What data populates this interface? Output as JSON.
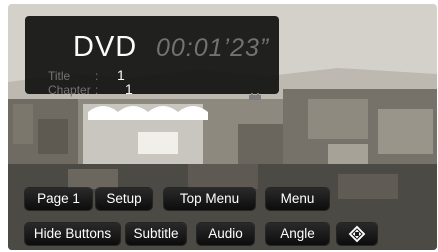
{
  "info": {
    "source": "DVD",
    "time": "00:01’23”",
    "title_label": "Title",
    "title_value": "1",
    "chapter_label": "Chapter",
    "chapter_value": "1",
    "colon": ":"
  },
  "buttons": {
    "row1": [
      "Page 1",
      "Setup",
      "Top Menu",
      "Menu"
    ],
    "row2": [
      "Hide Buttons",
      "Subtitle",
      "Audio",
      "Angle"
    ],
    "direction_icon": "direction-pad-icon"
  },
  "colors": {
    "panel": "#111111",
    "button": "#0c0c0c",
    "text": "#ffffff",
    "dim_text": "#6f6f6f"
  }
}
